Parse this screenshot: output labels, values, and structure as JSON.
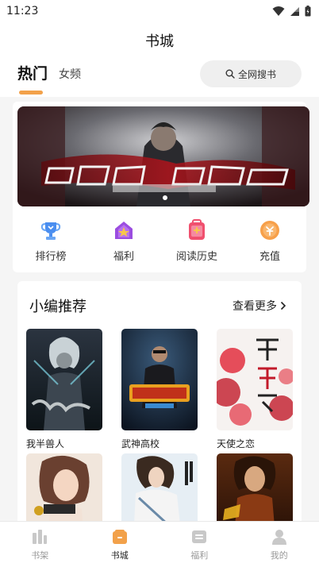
{
  "status_bar": {
    "time": "11:23"
  },
  "app": {
    "title": "书城"
  },
  "tabs": [
    {
      "label": "热门",
      "active": true
    },
    {
      "label": "女频",
      "active": false
    }
  ],
  "search": {
    "label": "全网搜书"
  },
  "banner": {
    "slides_visible": 1,
    "active_index": 0
  },
  "quick_nav": [
    {
      "label": "排行榜",
      "icon": "trophy-icon",
      "color": "#4a8ef0"
    },
    {
      "label": "福利",
      "icon": "gift-house-icon",
      "color": "#9b4de0"
    },
    {
      "label": "阅读历史",
      "icon": "history-bag-icon",
      "color": "#f0506e"
    },
    {
      "label": "充值",
      "icon": "coin-icon",
      "color": "#f7a04a"
    }
  ],
  "recommend": {
    "title": "小编推荐",
    "more_label": "查看更多",
    "books": [
      {
        "title": "我半兽人"
      },
      {
        "title": "武神高校"
      },
      {
        "title": "天使之恋"
      },
      {
        "title": ""
      },
      {
        "title": ""
      },
      {
        "title": ""
      }
    ]
  },
  "bottom_nav": [
    {
      "label": "书架",
      "icon": "bookshelf-icon",
      "active": false
    },
    {
      "label": "书城",
      "icon": "bookstore-icon",
      "active": true
    },
    {
      "label": "福利",
      "icon": "welfare-icon",
      "active": false
    },
    {
      "label": "我的",
      "icon": "profile-icon",
      "active": false
    }
  ],
  "colors": {
    "accent": "#f2a14a",
    "background": "#f5f5f5",
    "inactive": "#999999"
  }
}
